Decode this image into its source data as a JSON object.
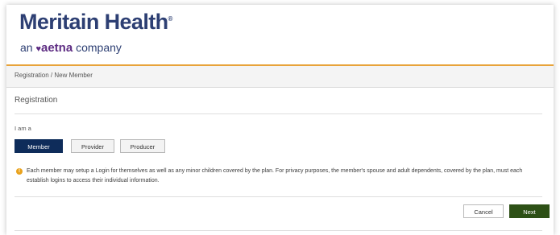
{
  "header": {
    "logo_main": "Meritain Health",
    "logo_sub_prefix": "an",
    "logo_sub_brand": "aetna",
    "logo_sub_suffix": "company",
    "heart_glyph": "♥",
    "registered_mark": "®"
  },
  "breadcrumb": "Registration / New Member",
  "page_title": "Registration",
  "role_prompt": "I am a",
  "roles": [
    "Member",
    "Provider",
    "Producer"
  ],
  "selected_role": "Member",
  "info_text": "Each member may setup a Login for themselves as well as any minor children covered by the plan. For privacy purposes, the member's spouse and adult dependents, covered by the plan, must each establish logins to access their individual information.",
  "actions": {
    "cancel": "Cancel",
    "next": "Next"
  },
  "colors": {
    "brand_navy": "#2d3f73",
    "aetna_purple": "#5e2d83",
    "accent_orange": "#e8a33a",
    "selected_button": "#0e2c5a",
    "next_button": "#2d5016"
  }
}
